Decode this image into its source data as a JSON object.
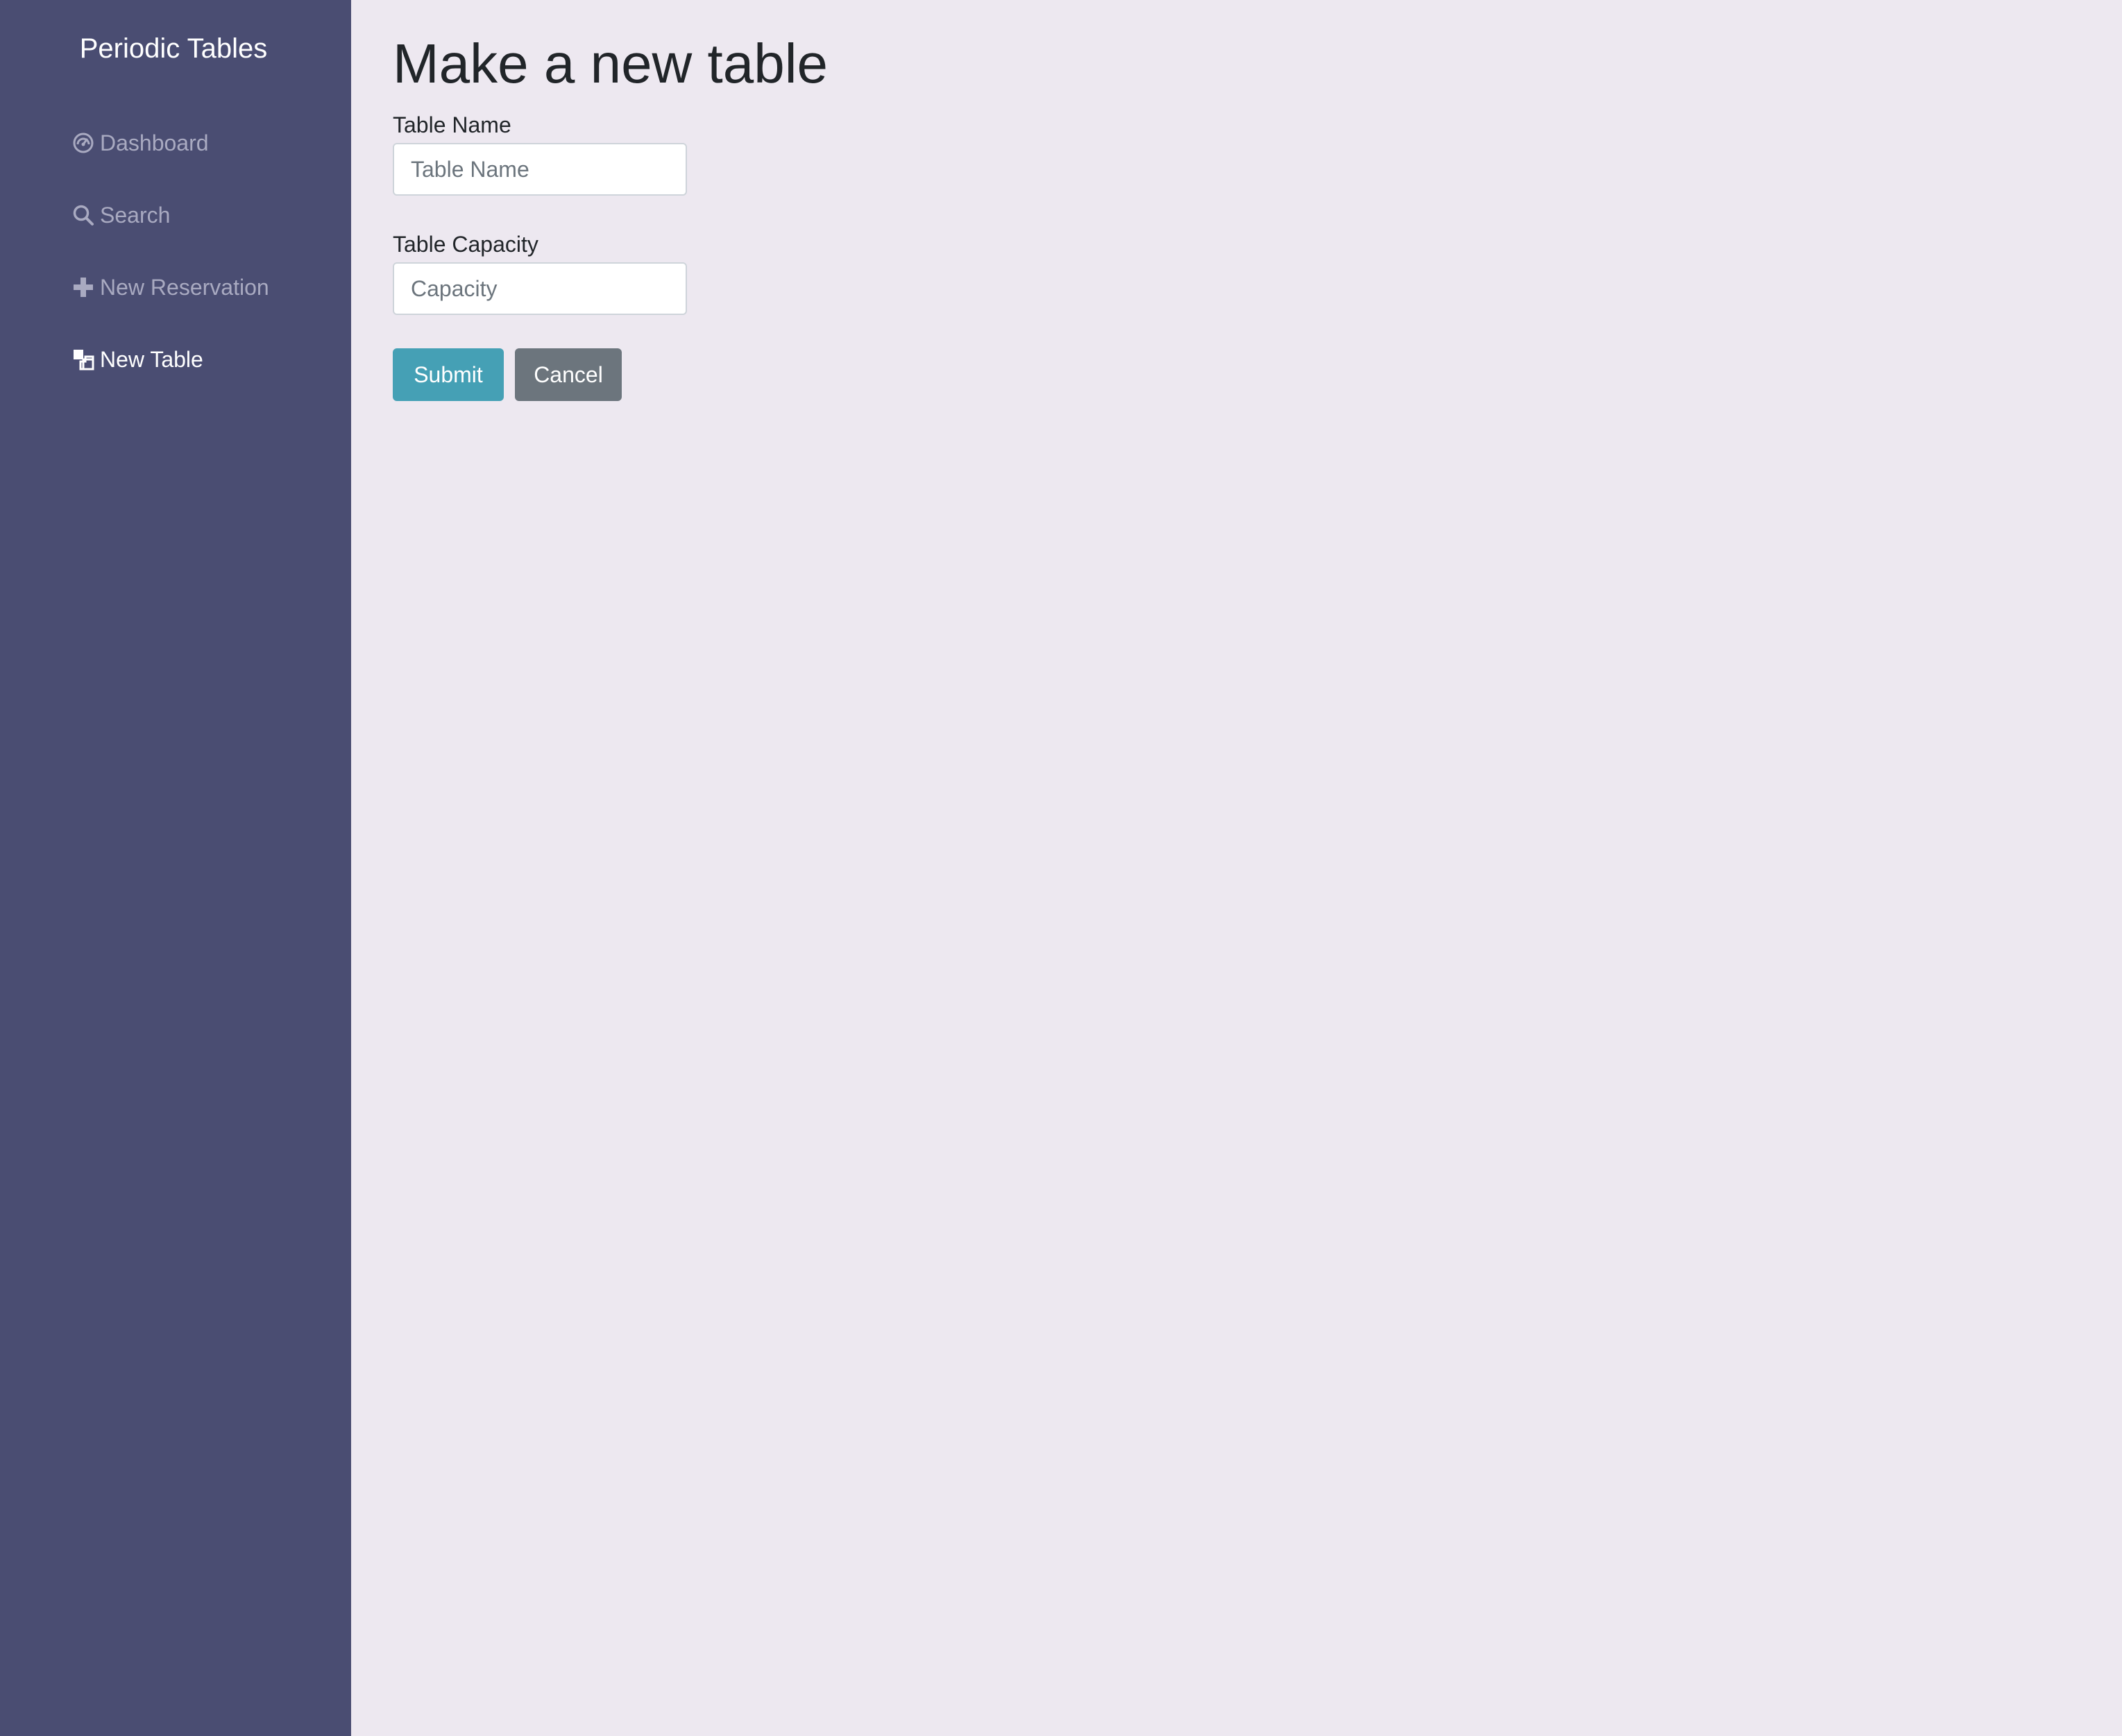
{
  "app": {
    "brand": "Periodic Tables"
  },
  "sidebar": {
    "items": [
      {
        "label": "Dashboard",
        "icon": "dashboard-icon",
        "active": false
      },
      {
        "label": "Search",
        "icon": "search-icon",
        "active": false
      },
      {
        "label": "New Reservation",
        "icon": "plus-icon",
        "active": false
      },
      {
        "label": "New Table",
        "icon": "new-table-icon",
        "active": true
      }
    ]
  },
  "main": {
    "title": "Make a new table",
    "form": {
      "table_name": {
        "label": "Table Name",
        "placeholder": "Table Name",
        "value": ""
      },
      "capacity": {
        "label": "Table Capacity",
        "placeholder": "Capacity",
        "value": ""
      },
      "submit_label": "Submit",
      "cancel_label": "Cancel"
    }
  },
  "colors": {
    "sidebar_bg": "#4a4d72",
    "page_bg": "#ede8f0",
    "submit_bg": "#45a0b5",
    "cancel_bg": "#6c757d",
    "nav_inactive": "#a9aac1",
    "nav_active": "#ffffff"
  }
}
